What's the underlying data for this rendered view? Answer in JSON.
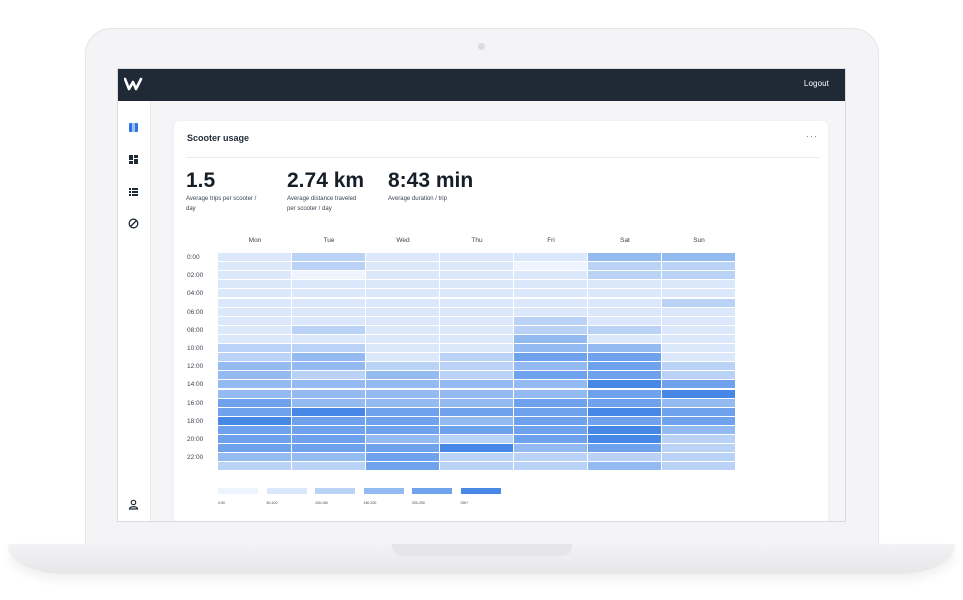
{
  "header": {
    "logout_label": "Logout"
  },
  "sidebar": {
    "items": [
      {
        "icon": "map-icon",
        "active": true
      },
      {
        "icon": "dashboard-icon",
        "active": false
      },
      {
        "icon": "list-icon",
        "active": false
      },
      {
        "icon": "block-icon",
        "active": false
      },
      {
        "icon": "user-icon",
        "active": false
      }
    ]
  },
  "card": {
    "title": "Scooter usage",
    "menu": "···"
  },
  "stats": [
    {
      "value": "1.5",
      "label_line1": "Average trips per scooter /",
      "label_line2": "day"
    },
    {
      "value": "2.74 km",
      "label_line1": "Average distance traveled",
      "label_line2": "per scooter / day"
    },
    {
      "value": "8:43 min",
      "label_line1": "Average duration / trip",
      "label_line2": ""
    }
  ],
  "colors": {
    "scale": [
      "#eef4fd",
      "#dbe8fb",
      "#b9d2f5",
      "#94bbf1",
      "#6fa2ec",
      "#4787e6"
    ],
    "topbar": "#1f2a36"
  },
  "chart_data": {
    "type": "heatmap",
    "days": [
      "Mon",
      "Tue",
      "Wed",
      "Thu",
      "Fri",
      "Sat",
      "Sun"
    ],
    "time_labels": [
      "0:00",
      "02:00",
      "04:00",
      "06:00",
      "08:00",
      "10:00",
      "12:00",
      "14:00",
      "16:00",
      "18:00",
      "20:00",
      "22:00"
    ],
    "hours": 24,
    "levels": [
      [
        1,
        2,
        1,
        1,
        1,
        3,
        3
      ],
      [
        1,
        2,
        1,
        1,
        0,
        2,
        2
      ],
      [
        1,
        0,
        1,
        1,
        1,
        2,
        2
      ],
      [
        1,
        1,
        1,
        1,
        1,
        1,
        1
      ],
      [
        1,
        1,
        1,
        1,
        1,
        1,
        1
      ],
      [
        1,
        1,
        1,
        1,
        1,
        1,
        2
      ],
      [
        1,
        1,
        1,
        1,
        1,
        1,
        1
      ],
      [
        1,
        1,
        1,
        1,
        2,
        1,
        1
      ],
      [
        1,
        2,
        1,
        1,
        2,
        2,
        1
      ],
      [
        1,
        1,
        1,
        1,
        3,
        1,
        1
      ],
      [
        2,
        2,
        1,
        1,
        3,
        3,
        1
      ],
      [
        2,
        3,
        1,
        2,
        4,
        4,
        1
      ],
      [
        3,
        3,
        2,
        2,
        3,
        4,
        2
      ],
      [
        3,
        2,
        3,
        2,
        4,
        4,
        2
      ],
      [
        3,
        3,
        3,
        3,
        3,
        5,
        4
      ],
      [
        3,
        3,
        3,
        3,
        3,
        4,
        5
      ],
      [
        4,
        3,
        3,
        3,
        4,
        4,
        3
      ],
      [
        4,
        5,
        4,
        4,
        4,
        5,
        4
      ],
      [
        5,
        4,
        4,
        3,
        4,
        4,
        4
      ],
      [
        4,
        4,
        4,
        4,
        4,
        5,
        3
      ],
      [
        4,
        4,
        3,
        2,
        4,
        5,
        2
      ],
      [
        4,
        4,
        4,
        5,
        3,
        4,
        2
      ],
      [
        3,
        3,
        4,
        2,
        2,
        2,
        2
      ],
      [
        2,
        2,
        4,
        2,
        2,
        3,
        2
      ]
    ],
    "legend": [
      "0-50",
      "50-100",
      "100-150",
      "150-200",
      "200-250",
      "250+"
    ]
  }
}
